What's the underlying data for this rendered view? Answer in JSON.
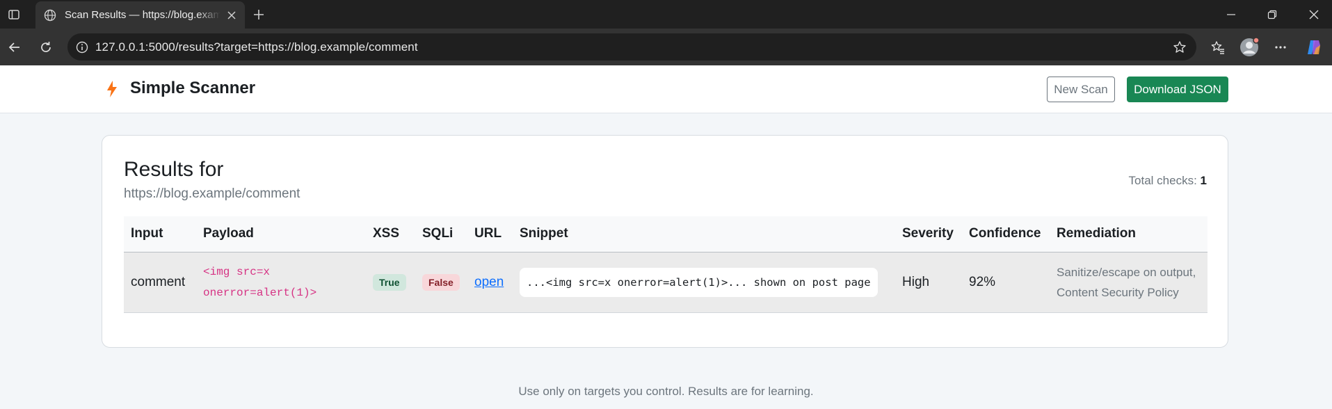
{
  "browser": {
    "tab_title": "Scan Results — https://blog.example/comment",
    "url": "127.0.0.1:5000/results?target=https://blog.example/comment"
  },
  "app": {
    "brand": "Simple Scanner",
    "new_scan_label": "New Scan",
    "download_label": "Download JSON"
  },
  "results": {
    "title": "Results for",
    "target": "https://blog.example/comment",
    "total_label": "Total checks:",
    "total_value": "1",
    "columns": [
      "Input",
      "Payload",
      "XSS",
      "SQLi",
      "URL",
      "Snippet",
      "Severity",
      "Confidence",
      "Remediation"
    ],
    "rows": [
      {
        "input": "comment",
        "payload": "<img src=x onerror=alert(1)>",
        "xss": "True",
        "sqli": "False",
        "url_label": "open",
        "snippet": "...<img src=x onerror=alert(1)>... shown on post page",
        "severity": "High",
        "confidence": "92%",
        "remediation": "Sanitize/escape on output, Content Security Policy"
      }
    ]
  },
  "footer": "Use only on targets you control. Results are for learning.",
  "colors": {
    "accent_green": "#198754",
    "payload_pink": "#d63384",
    "link_blue": "#0d6efd",
    "brand_bolt": "#f97316"
  }
}
